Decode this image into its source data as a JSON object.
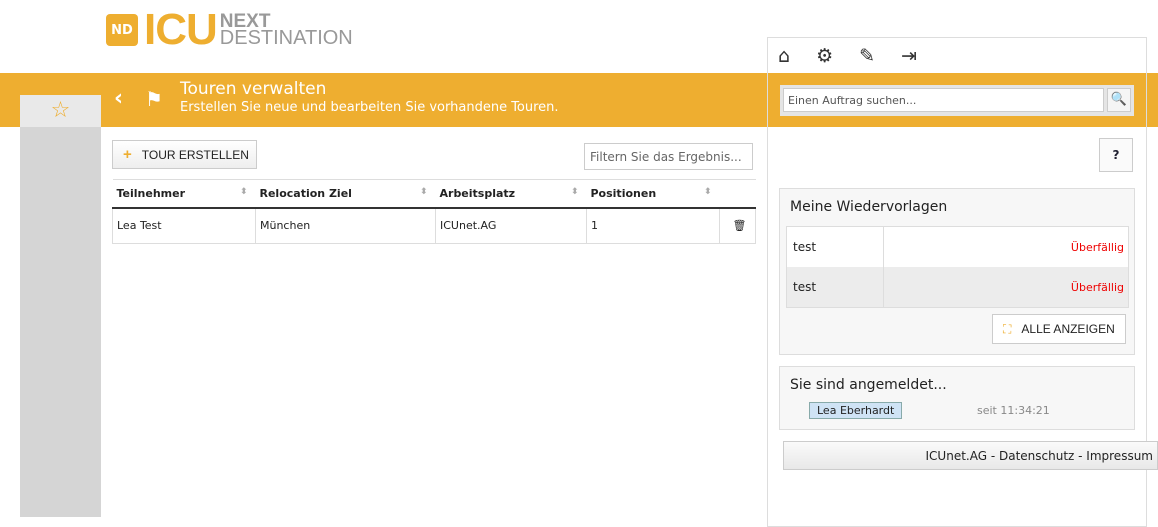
{
  "logo": {
    "mark": "ND",
    "brand": "ICU",
    "line1": "NEXT",
    "line2": "DESTINATION"
  },
  "header": {
    "title": "Touren verwalten",
    "subtitle": "Erstellen Sie neue und bearbeiten Sie vorhandene Touren."
  },
  "actions": {
    "create_label": "TOUR ERSTELLEN",
    "filter_placeholder": "Filtern Sie das Ergebnis..."
  },
  "table": {
    "columns": [
      "Teilnehmer",
      "Relocation Ziel",
      "Arbeitsplatz",
      "Positionen"
    ],
    "rows": [
      {
        "teilnehmer": "Lea Test",
        "ziel": "München",
        "arbeitsplatz": "ICUnet.AG",
        "positionen": "1"
      }
    ]
  },
  "right": {
    "search_placeholder": "Einen Auftrag suchen...",
    "help": "?",
    "wiedervorlagen": {
      "title": "Meine Wiedervorlagen",
      "items": [
        {
          "name": "test",
          "status": "Überfällig"
        },
        {
          "name": "test",
          "status": "Überfällig"
        }
      ],
      "show_all": "ALLE ANZEIGEN"
    },
    "login": {
      "title": "Sie sind angemeldet...",
      "user": "Lea Eberhardt",
      "since": "seit 11:34:21"
    },
    "footer": "ICUnet.AG - Datenschutz - Impressum"
  },
  "colors": {
    "accent": "#eeae30",
    "overdue": "#ee0000"
  }
}
